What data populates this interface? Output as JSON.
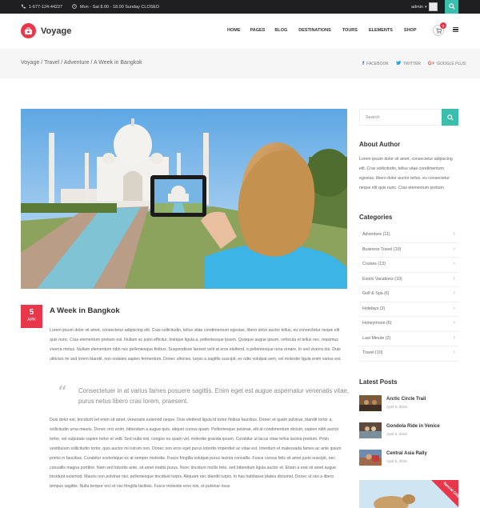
{
  "topbar": {
    "phone": "1-677-124-44227",
    "hours": "Mon - Sat 8.00 - 18.00 Sunday CLOSED",
    "user": "admin"
  },
  "header": {
    "logo_text": "Voyage",
    "nav": [
      "HOME",
      "PAGES",
      "BLOG",
      "DESTINATIONS",
      "TOURS",
      "ELEMENTS",
      "SHOP"
    ],
    "cart_count": "0"
  },
  "breadcrumb": {
    "text": "Voyage / Travel / Adventure / A Week in Bangkok"
  },
  "share": {
    "facebook": "FACEBOOK",
    "twitter": "TWITTER",
    "google": "GOOGLE PLUS"
  },
  "post": {
    "day": "5",
    "month": "APR",
    "title": "A Week in Bangkok",
    "paragraph1": "Lorem ipsum dolor sit amet, consectetur adipiscing elit. Cras sollicitudin, tellus vitae condimentum egestas, libero dolor auctor tellus, eu consectetur neque elit quis nunc. Cras elementum pretium est. Nullam ac justo efficitur, tristique ligula a, pellentesque ipsum. Quisque augue ipsum, vehicula et tellus nec, maximus viverra metus. Nullam elementum nibh nec pellentesque finibus. Suspendisse laoreet velit at eros eleifend, a pellentesque urna ornare. In sed viverra dui. Duis ultricies mi sed lorem blandit, non sodales sapien fermentum. Donec ultricies, turpis a sagittis suscipit, ex odio volutpat sem, vel molestie ligula enim varius est.",
    "quote": "Consectetuer in at varius fames posuere sagittis. Enim eget est augue aspernatur venenatis vitae, purus netus libero cras lorem, praesent.",
    "paragraph2": "Duis dolor est, tincidunt vel enim sit amet, venenatis euismod neque. Duis eleifend ligula id tortor finibus faucibus. Donec et quam pulvinar, blandit tortor a, sollicitudin urna mauris. Donec orci enim, bibendum a augue quis, aliquet cursus quam. Pellentesque pulvinar, elit at condimentum dictum, sapien nibh auctor tortor, vel vulputate sapien tortor et velit. Sed nulla nisi, congue eu quam vel, molestie gravida ipsum. Curabitur ut lacus vitae tellus lacinia pretium. Proin vestibulum sollicitudin tortor, quis auctor mi rutrum non. Donec non eros eget purus lobortis imperdiet ac vitae est. Interdum et malesuada fames ac ante ipsum primis in faucibus. Curabitur scelerisque ex at semper molestie. Fusce fringilla volutpat purus lacinia convallis. Fusce cursus felis sit amet justo suscipit, nec convallis magna porttitor. Nam sed lobortis ante, sit amet mattis purus. Nunc tincidunt mollis felis, sed bibendum ligula auctor et. Etiam a erat sit amet augue tincidunt euismod. Mauris non pulvinar nisi, pellentesque tincidunt turpis. Aliquam nec blandit turpis. In has habitasse platea dictumst. Donec ut nisi a libero tempus sagittis. Nulla tempor orci et nisi fringilla facilisis. Fusce molestie eros nisi, et pulvinar risus"
  },
  "sidebar": {
    "search_placeholder": "Search",
    "about_title": "About Author",
    "about_text": "Lorem ipsum dolor sit amet, consectetur adipiscing elit. Cras sollicitudin, tellus vitae condimentum egestas, libero dolor auctor tellus, eu consectetur neque elit quis nunc. Cras elementum pretium",
    "categories_title": "Categories",
    "categories": [
      "Adventure (11)",
      "Business Travel (10)",
      "Cruises (13)",
      "Exotic Vacations (10)",
      "Golf & Spa (6)",
      "Holidays (3)",
      "Honeymoon (6)",
      "Last Minute (2)",
      "Travel (10)"
    ],
    "latest_title": "Latest Posts",
    "latest": [
      {
        "title": "Arctic Circle Trail",
        "date": "April 5, 2016"
      },
      {
        "title": "Gondola Ride in Venice",
        "date": "April 5, 2016"
      },
      {
        "title": "Central Asia Rally",
        "date": "April 5, 2016"
      }
    ],
    "promo_ribbon": "Special Offer"
  },
  "colors": {
    "accent_teal": "#3bbfad",
    "accent_red": "#e8364a",
    "topbar_bg": "#1f1f22"
  }
}
